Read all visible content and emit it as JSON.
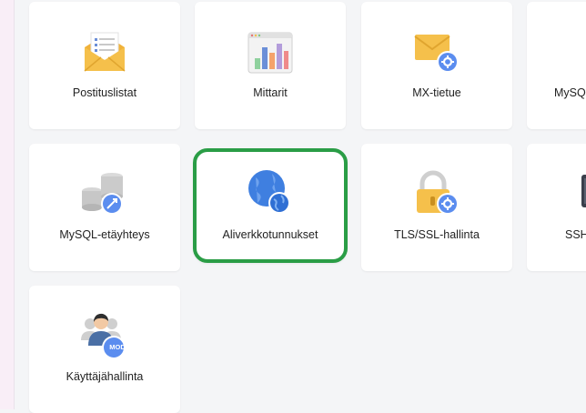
{
  "tiles": [
    {
      "label": "Postituslistat",
      "icon": "mailing-list-icon"
    },
    {
      "label": "Mittarit",
      "icon": "metrics-chart-icon"
    },
    {
      "label": "MX-tietue",
      "icon": "mx-record-icon"
    },
    {
      "label": "MySQ",
      "icon": "mysql-database-icon"
    },
    {
      "label": "MySQL-etäyhteys",
      "icon": "mysql-remote-icon"
    },
    {
      "label": "Aliverkkotunnukset",
      "icon": "subdomain-globe-icon",
      "selected": true
    },
    {
      "label": "TLS/SSL-hallinta",
      "icon": "ssl-lock-icon"
    },
    {
      "label": "SSH",
      "icon": "ssh-terminal-icon"
    },
    {
      "label": "Käyttäjähallinta",
      "icon": "user-management-icon",
      "badge": "MOD"
    }
  ],
  "colors": {
    "highlight": "#2a9d46",
    "gear_badge": "#5b8def",
    "envelope": "#f5c04b",
    "globe": "#3f7fe0"
  }
}
